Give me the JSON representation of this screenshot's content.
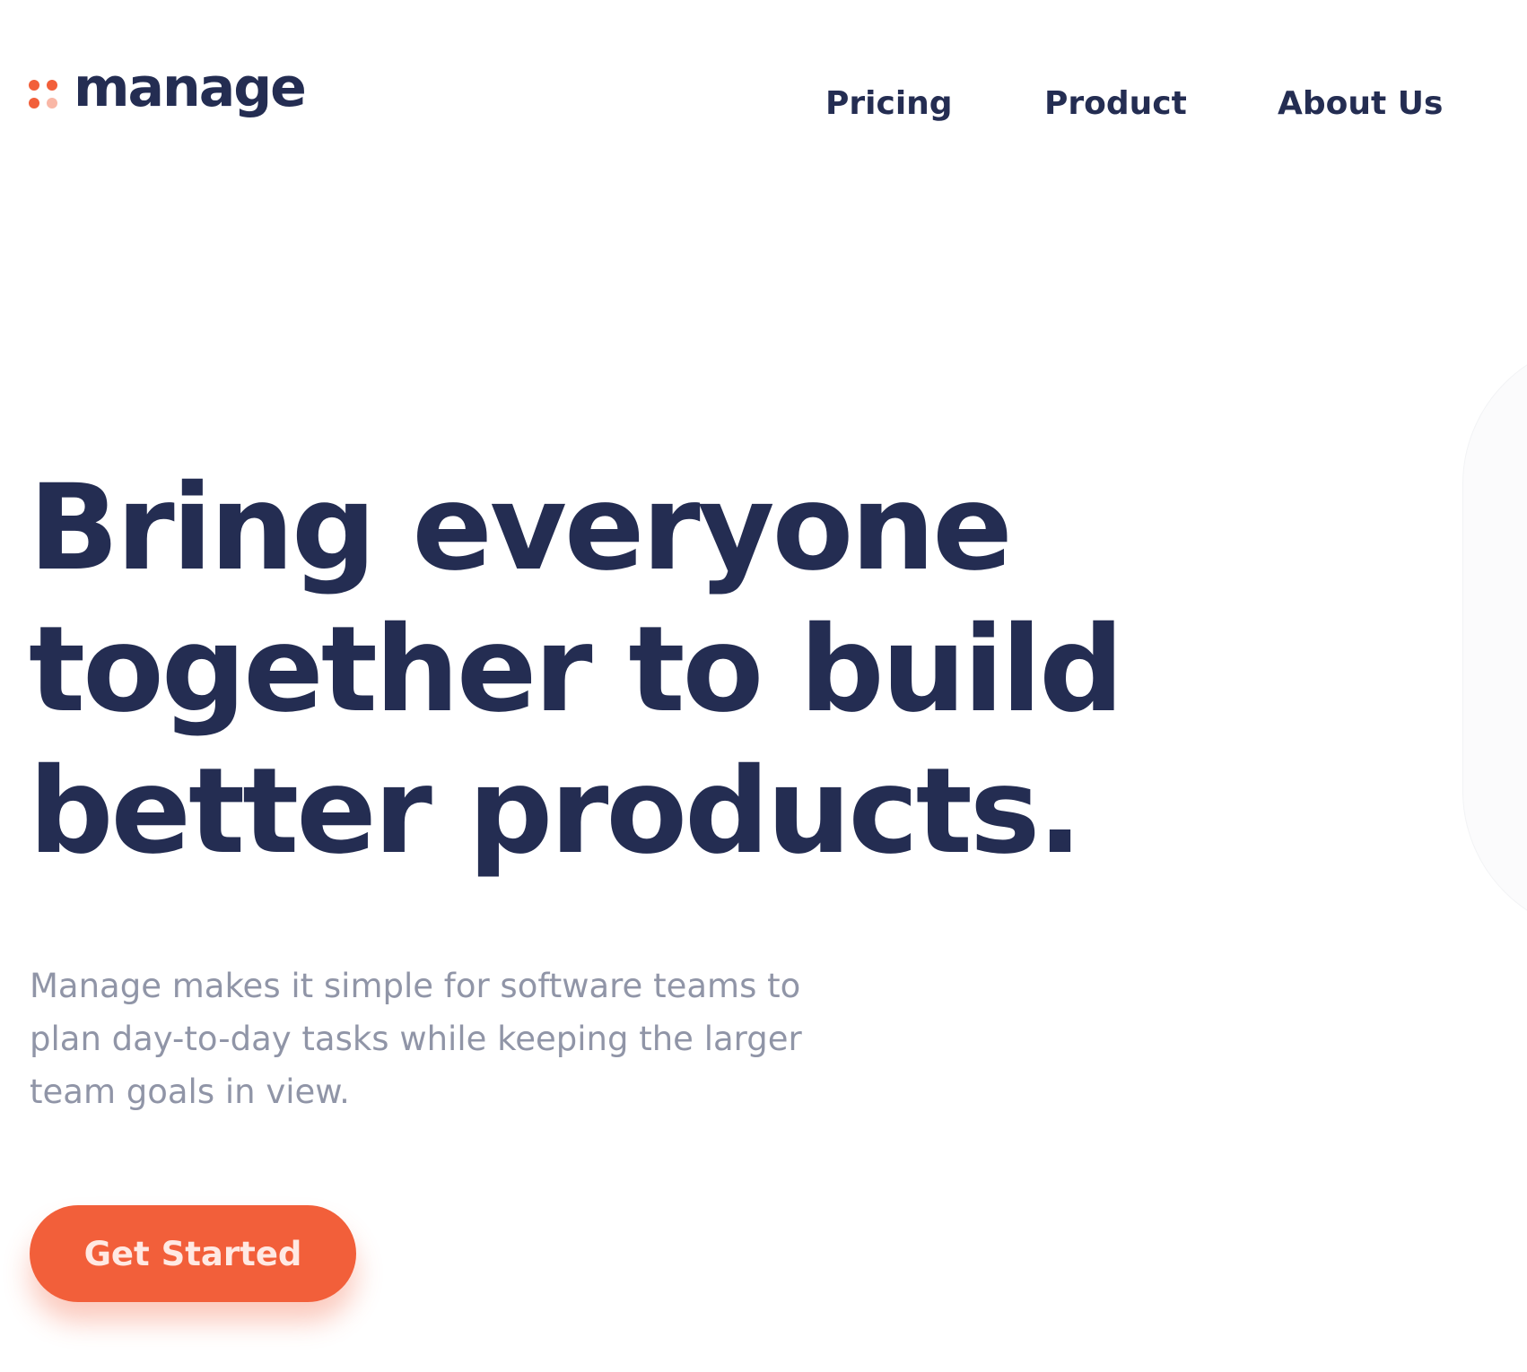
{
  "brand": {
    "name": "manage",
    "colors": {
      "primary_dark": "#242d52",
      "accent": "#f25f3a",
      "accent_light": "#f9b7a6",
      "muted_text": "#9095a7"
    }
  },
  "nav": {
    "items": [
      {
        "label": "Pricing"
      },
      {
        "label": "Product"
      },
      {
        "label": "About Us"
      }
    ]
  },
  "hero": {
    "title": "Bring everyone together to build better products.",
    "description": "Manage makes it simple for software teams to plan day-to-day tasks while keeping the larger team goals in view.",
    "cta_label": "Get Started"
  }
}
